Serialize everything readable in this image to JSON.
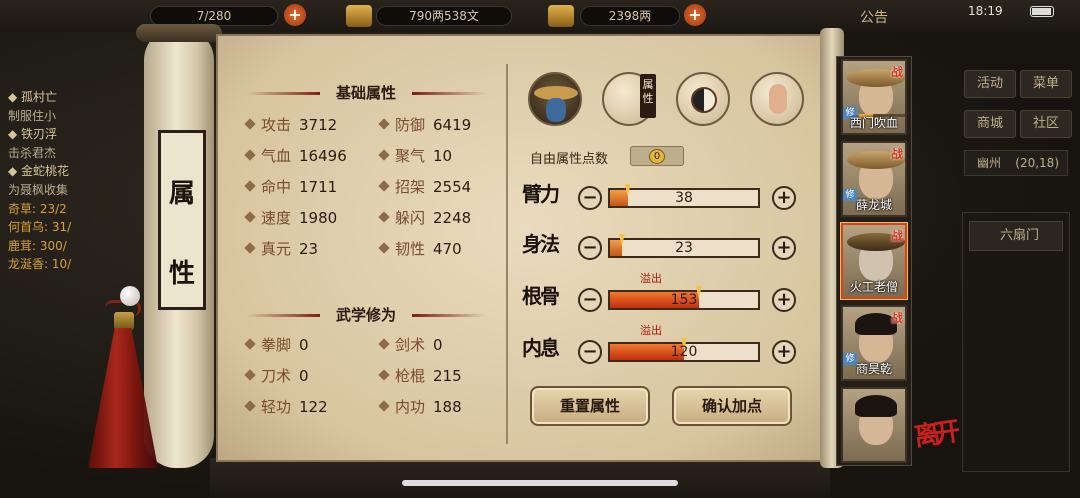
{
  "status_bar": {
    "time": "18:19"
  },
  "top_bar": {
    "capacity": "7/280",
    "silver": "790两538文",
    "gold": "2398两",
    "announcement": "公告",
    "plus": "+"
  },
  "quests": [
    {
      "title": "孤村亡",
      "desc": "制服住小",
      "progress": ""
    },
    {
      "title": "铁刃浮",
      "desc": "击杀君杰",
      "progress": ""
    },
    {
      "title": "金蛇桃花",
      "desc": "为聂枫收集",
      "progress": ""
    }
  ],
  "quest_progress": [
    "奇草: 23/2",
    "何首乌: 31/",
    "鹿茸: 300/",
    "龙涎香: 10/"
  ],
  "right_panel": {
    "buttons": [
      "活动",
      "菜单",
      "商城",
      "社区"
    ],
    "location": "幽州",
    "coords": "(20,18)",
    "list_item": "六扇门"
  },
  "scroll_label": [
    "属",
    "性"
  ],
  "basic_attrs": {
    "title": "基础属性",
    "items": [
      {
        "name": "攻击",
        "value": "3712"
      },
      {
        "name": "防御",
        "value": "6419"
      },
      {
        "name": "气血",
        "value": "16496"
      },
      {
        "name": "聚气",
        "value": "10"
      },
      {
        "name": "命中",
        "value": "1711"
      },
      {
        "name": "招架",
        "value": "2554"
      },
      {
        "name": "速度",
        "value": "1980"
      },
      {
        "name": "躲闪",
        "value": "2248"
      },
      {
        "name": "真元",
        "value": "23"
      },
      {
        "name": "韧性",
        "value": "470"
      }
    ]
  },
  "martial": {
    "title": "武学修为",
    "items": [
      {
        "name": "拳脚",
        "value": "0"
      },
      {
        "name": "剑术",
        "value": "0"
      },
      {
        "name": "刀术",
        "value": "0"
      },
      {
        "name": "枪棍",
        "value": "215"
      },
      {
        "name": "轻功",
        "value": "122"
      },
      {
        "name": "内功",
        "value": "188"
      }
    ]
  },
  "tabs": [
    {
      "icon": "hat-character-icon"
    },
    {
      "icon": "attribute-book-icon",
      "badge": "属性"
    },
    {
      "icon": "bagua-icon"
    },
    {
      "icon": "meridian-body-icon"
    }
  ],
  "free_points": {
    "label": "自由属性点数",
    "value": "0"
  },
  "allocation": [
    {
      "label": "臂力",
      "value": "38",
      "fill": 0.12,
      "overflow": ""
    },
    {
      "label": "身法",
      "value": "23",
      "fill": 0.08,
      "overflow": ""
    },
    {
      "label": "根骨",
      "value": "153",
      "fill": 0.6,
      "overflow": "溢出"
    },
    {
      "label": "内息",
      "value": "120",
      "fill": 0.5,
      "overflow": "溢出"
    }
  ],
  "controls": {
    "minus": "−",
    "plus": "+"
  },
  "actions": {
    "reset": "重置属性",
    "confirm": "确认加点"
  },
  "roster": [
    {
      "name": "西门吹血",
      "zhan": "战",
      "xiu": "修"
    },
    {
      "name": "薛龙城",
      "zhan": "战",
      "xiu": "修"
    },
    {
      "name": "火工老僧",
      "zhan": "战",
      "xiu": ""
    },
    {
      "name": "商昊乾",
      "zhan": "战",
      "xiu": "修"
    },
    {
      "name": "",
      "zhan": "",
      "xiu": ""
    }
  ],
  "leave": "离开",
  "colors": {
    "accent_red": "#c8201a",
    "bar_orange": "#c25617",
    "parchment": "#e9dbbd"
  }
}
